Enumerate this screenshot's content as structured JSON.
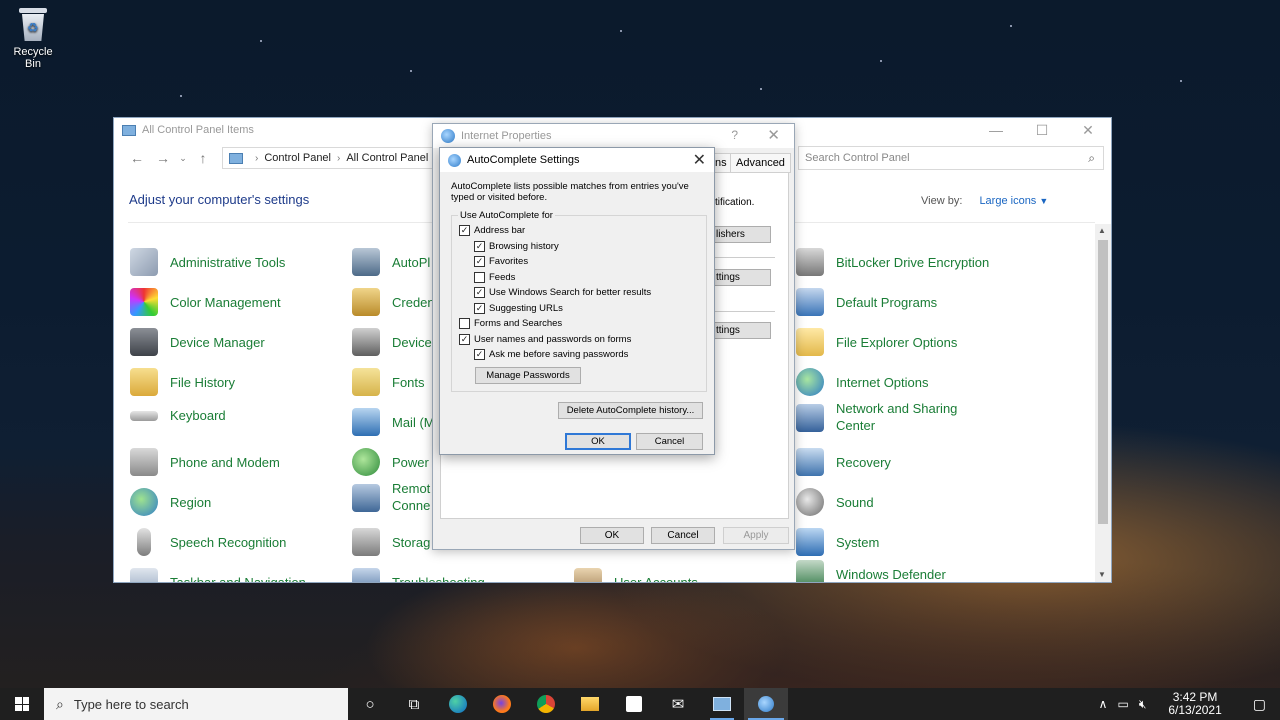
{
  "desktop": {
    "recycle_bin_label": "Recycle Bin"
  },
  "control_panel": {
    "title": "All Control Panel Items",
    "breadcrumb": [
      "Control Panel",
      "All Control Panel Items"
    ],
    "search_placeholder": "Search Control Panel",
    "heading": "Adjust your computer's settings",
    "view_by_label": "View by:",
    "view_by_value": "Large icons",
    "items_col1": [
      "Administrative Tools",
      "Color Management",
      "Device Manager",
      "File History",
      "Keyboard",
      "Phone and Modem",
      "Region",
      "Speech Recognition",
      "Taskbar and Navigation"
    ],
    "items_col2": [
      "AutoPlay",
      "Credential Manager",
      "Devices and Printers",
      "Fonts",
      "Mail (Microsoft Outlook)",
      "Power Options",
      "RemoteApp and Desktop Connections",
      "Storage Spaces",
      "Troubleshooting"
    ],
    "items_col2_visible": [
      "AutoPl",
      "Creden",
      "Device",
      "Fonts",
      "Mail (M",
      "Power",
      "Remot",
      "Storag",
      "Troubleshooting"
    ],
    "items_col2_line2": [
      "",
      "",
      "",
      "",
      "",
      "",
      "Conne",
      "",
      ""
    ],
    "items_col3_visible": [
      "User Accounts"
    ],
    "items_col4": [
      "BitLocker Drive Encryption",
      "Default Programs",
      "File Explorer Options",
      "Internet Options",
      "Network and Sharing",
      "Recovery",
      "Sound",
      "System",
      "Windows Defender"
    ],
    "items_col4_line2": [
      "",
      "",
      "",
      "",
      "Center",
      "",
      "",
      "",
      ""
    ]
  },
  "internet_properties": {
    "title": "Internet Properties",
    "help": "?",
    "tabs_visible": [
      "ns",
      "Advanced"
    ],
    "text_fragment": "tification.",
    "button_fragments": [
      "lishers",
      "ttings",
      "ttings"
    ],
    "ok": "OK",
    "cancel": "Cancel",
    "apply": "Apply"
  },
  "autocomplete": {
    "title": "AutoComplete Settings",
    "description": "AutoComplete lists possible matches from entries you've typed or visited before.",
    "group_label": "Use AutoComplete for",
    "options": [
      {
        "label": "Address bar",
        "checked": true,
        "indent": 0
      },
      {
        "label": "Browsing history",
        "checked": true,
        "indent": 1
      },
      {
        "label": "Favorites",
        "checked": true,
        "indent": 1
      },
      {
        "label": "Feeds",
        "checked": false,
        "indent": 1
      },
      {
        "label": "Use Windows Search for better results",
        "checked": true,
        "indent": 1
      },
      {
        "label": "Suggesting URLs",
        "checked": true,
        "indent": 1
      },
      {
        "label": "Forms and Searches",
        "checked": false,
        "indent": 0
      },
      {
        "label": "User names and passwords on forms",
        "checked": true,
        "indent": 0
      },
      {
        "label": "Ask me before saving passwords",
        "checked": true,
        "indent": 1
      }
    ],
    "manage_passwords": "Manage Passwords",
    "delete_history": "Delete AutoComplete history...",
    "ok": "OK",
    "cancel": "Cancel"
  },
  "taskbar": {
    "search_placeholder": "Type here to search",
    "time": "3:42 PM",
    "date": "6/13/2021"
  },
  "colors": {
    "link_green": "#1a7d36",
    "heading_blue": "#1e3b8a",
    "accent": "#2f78d6"
  }
}
